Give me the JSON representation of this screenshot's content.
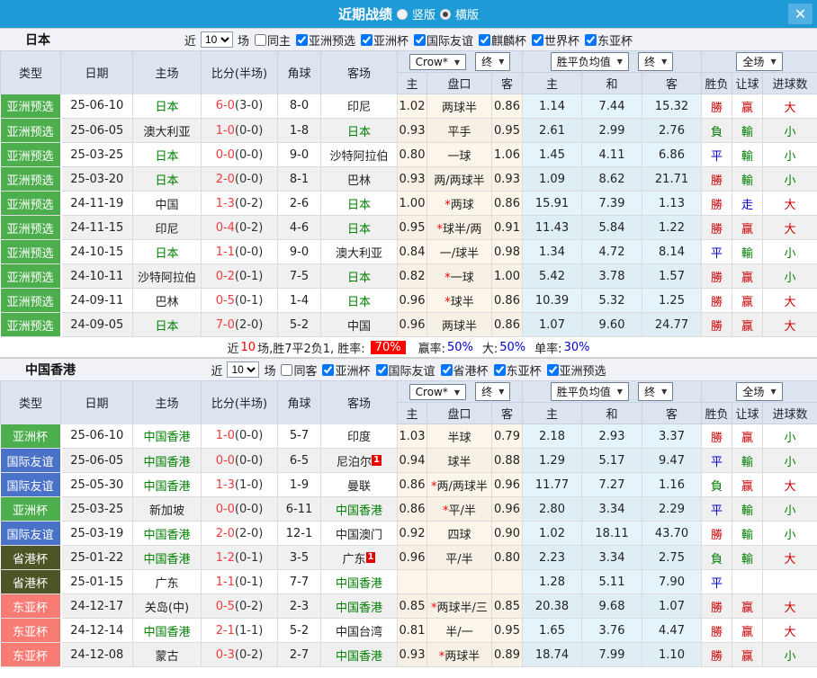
{
  "palette": {
    "topbar": "#1E9BD7",
    "close_btn": "#54AFE2",
    "header_bg": "#DCE4F0",
    "section_bg": "#F1F2F7",
    "type_green": "#4CAE4C",
    "type_blue": "#4A72C8",
    "type_olive": "#4D5426",
    "type_salmon": "#F87C74",
    "focal_team": "#008000",
    "score_red": "#F23B3B",
    "win": "#CC0000",
    "lose": "#008000",
    "draw": "#0000CC",
    "rate_badge_bg": "#FF0000",
    "rate_value_blue": "#0000CC"
  },
  "titlebar": {
    "title": "近期战绩",
    "radio_vertical": "竖版",
    "radio_horizontal": "横版",
    "close": "✕"
  },
  "columns": {
    "type": "类型",
    "date": "日期",
    "home": "主场",
    "score": "比分(半场)",
    "corner": "角球",
    "away": "客场",
    "odds_home": "主",
    "handicap": "盘口",
    "odds_away": "客",
    "mean_home": "主",
    "mean_draw": "和",
    "mean_away": "客",
    "wdl": "胜负",
    "handicap_result": "让球",
    "goals": "进球数"
  },
  "controls": {
    "source": "Crow*",
    "final1": "终",
    "mean": "胜平负均值",
    "final2": "终",
    "scope": "全场"
  },
  "sections": [
    {
      "team": "日本",
      "filters": {
        "near_label": "近",
        "count": "10",
        "games_label": "场",
        "same_label": "同主",
        "same_checked": false,
        "cups": [
          "亚洲预选",
          "亚洲杯",
          "国际友谊",
          "麒麟杯",
          "世界杯",
          "东亚杯"
        ]
      },
      "rows": [
        {
          "type": "亚洲预选",
          "type_color": "green",
          "date": "25-06-10",
          "home": "日本",
          "home_focal": true,
          "home_badge": "",
          "score": "6-0",
          "half": "(3-0)",
          "corner": "8-0",
          "away": "印尼",
          "away_focal": false,
          "away_badge": "",
          "odds_home": "1.02",
          "handicap": "两球半",
          "handicap_star": false,
          "odds_away": "0.86",
          "mean_home": "1.14",
          "mean_draw": "7.44",
          "mean_away": "15.32",
          "res_wdl": "勝",
          "res_wdl_c": "red",
          "res_let": "赢",
          "res_let_c": "red",
          "res_goal": "大",
          "res_goal_c": "red"
        },
        {
          "type": "亚洲预选",
          "type_color": "green",
          "date": "25-06-05",
          "home": "澳大利亚",
          "home_focal": false,
          "home_badge": "",
          "score": "1-0",
          "half": "(0-0)",
          "corner": "1-8",
          "away": "日本",
          "away_focal": true,
          "away_badge": "",
          "odds_home": "0.93",
          "handicap": "平手",
          "handicap_star": false,
          "odds_away": "0.95",
          "mean_home": "2.61",
          "mean_draw": "2.99",
          "mean_away": "2.76",
          "res_wdl": "負",
          "res_wdl_c": "green",
          "res_let": "輸",
          "res_let_c": "green",
          "res_goal": "小",
          "res_goal_c": "green"
        },
        {
          "type": "亚洲预选",
          "type_color": "green",
          "date": "25-03-25",
          "home": "日本",
          "home_focal": true,
          "home_badge": "",
          "score": "0-0",
          "half": "(0-0)",
          "corner": "9-0",
          "away": "沙特阿拉伯",
          "away_focal": false,
          "away_badge": "",
          "odds_home": "0.80",
          "handicap": "一球",
          "handicap_star": false,
          "odds_away": "1.06",
          "mean_home": "1.45",
          "mean_draw": "4.11",
          "mean_away": "6.86",
          "res_wdl": "平",
          "res_wdl_c": "blue",
          "res_let": "輸",
          "res_let_c": "green",
          "res_goal": "小",
          "res_goal_c": "green"
        },
        {
          "type": "亚洲预选",
          "type_color": "green",
          "date": "25-03-20",
          "home": "日本",
          "home_focal": true,
          "home_badge": "",
          "score": "2-0",
          "half": "(0-0)",
          "corner": "8-1",
          "away": "巴林",
          "away_focal": false,
          "away_badge": "",
          "odds_home": "0.93",
          "handicap": "两/两球半",
          "handicap_star": false,
          "odds_away": "0.93",
          "mean_home": "1.09",
          "mean_draw": "8.62",
          "mean_away": "21.71",
          "res_wdl": "勝",
          "res_wdl_c": "red",
          "res_let": "輸",
          "res_let_c": "green",
          "res_goal": "小",
          "res_goal_c": "green"
        },
        {
          "type": "亚洲预选",
          "type_color": "green",
          "date": "24-11-19",
          "home": "中国",
          "home_focal": false,
          "home_badge": "",
          "score": "1-3",
          "half": "(0-2)",
          "corner": "2-6",
          "away": "日本",
          "away_focal": true,
          "away_badge": "",
          "odds_home": "1.00",
          "handicap": "两球",
          "handicap_star": true,
          "odds_away": "0.86",
          "mean_home": "15.91",
          "mean_draw": "7.39",
          "mean_away": "1.13",
          "res_wdl": "勝",
          "res_wdl_c": "red",
          "res_let": "走",
          "res_let_c": "blue",
          "res_goal": "大",
          "res_goal_c": "red"
        },
        {
          "type": "亚洲预选",
          "type_color": "green",
          "date": "24-11-15",
          "home": "印尼",
          "home_focal": false,
          "home_badge": "",
          "score": "0-4",
          "half": "(0-2)",
          "corner": "4-6",
          "away": "日本",
          "away_focal": true,
          "away_badge": "",
          "odds_home": "0.95",
          "handicap": "球半/两",
          "handicap_star": true,
          "odds_away": "0.91",
          "mean_home": "11.43",
          "mean_draw": "5.84",
          "mean_away": "1.22",
          "res_wdl": "勝",
          "res_wdl_c": "red",
          "res_let": "赢",
          "res_let_c": "red",
          "res_goal": "大",
          "res_goal_c": "red"
        },
        {
          "type": "亚洲预选",
          "type_color": "green",
          "date": "24-10-15",
          "home": "日本",
          "home_focal": true,
          "home_badge": "",
          "score": "1-1",
          "half": "(0-0)",
          "corner": "9-0",
          "away": "澳大利亚",
          "away_focal": false,
          "away_badge": "",
          "odds_home": "0.84",
          "handicap": "一/球半",
          "handicap_star": false,
          "odds_away": "0.98",
          "mean_home": "1.34",
          "mean_draw": "4.72",
          "mean_away": "8.14",
          "res_wdl": "平",
          "res_wdl_c": "blue",
          "res_let": "輸",
          "res_let_c": "green",
          "res_goal": "小",
          "res_goal_c": "green"
        },
        {
          "type": "亚洲预选",
          "type_color": "green",
          "date": "24-10-11",
          "home": "沙特阿拉伯",
          "home_focal": false,
          "home_badge": "",
          "score": "0-2",
          "half": "(0-1)",
          "corner": "7-5",
          "away": "日本",
          "away_focal": true,
          "away_badge": "",
          "odds_home": "0.82",
          "handicap": "一球",
          "handicap_star": true,
          "odds_away": "1.00",
          "mean_home": "5.42",
          "mean_draw": "3.78",
          "mean_away": "1.57",
          "res_wdl": "勝",
          "res_wdl_c": "red",
          "res_let": "赢",
          "res_let_c": "red",
          "res_goal": "小",
          "res_goal_c": "green"
        },
        {
          "type": "亚洲预选",
          "type_color": "green",
          "date": "24-09-11",
          "home": "巴林",
          "home_focal": false,
          "home_badge": "",
          "score": "0-5",
          "half": "(0-1)",
          "corner": "1-4",
          "away": "日本",
          "away_focal": true,
          "away_badge": "",
          "odds_home": "0.96",
          "handicap": "球半",
          "handicap_star": true,
          "odds_away": "0.86",
          "mean_home": "10.39",
          "mean_draw": "5.32",
          "mean_away": "1.25",
          "res_wdl": "勝",
          "res_wdl_c": "red",
          "res_let": "赢",
          "res_let_c": "red",
          "res_goal": "大",
          "res_goal_c": "red"
        },
        {
          "type": "亚洲预选",
          "type_color": "green",
          "date": "24-09-05",
          "home": "日本",
          "home_focal": true,
          "home_badge": "",
          "score": "7-0",
          "half": "(2-0)",
          "corner": "5-2",
          "away": "中国",
          "away_focal": false,
          "away_badge": "",
          "odds_home": "0.96",
          "handicap": "两球半",
          "handicap_star": false,
          "odds_away": "0.86",
          "mean_home": "1.07",
          "mean_draw": "9.60",
          "mean_away": "24.77",
          "res_wdl": "勝",
          "res_wdl_c": "red",
          "res_let": "赢",
          "res_let_c": "red",
          "res_goal": "大",
          "res_goal_c": "red"
        }
      ],
      "summary": {
        "prefix": "近",
        "count": "10",
        "mid": "场,胜7平2负1, 胜率:",
        "win_rate": "70%",
        "label2": "赢率:",
        "value2": "50%",
        "label3": "大:",
        "value3": "50%",
        "label4": "单率:",
        "value4": "30%"
      }
    },
    {
      "team": "中国香港",
      "filters": {
        "near_label": "近",
        "count": "10",
        "games_label": "场",
        "same_label": "同客",
        "same_checked": false,
        "cups": [
          "亚洲杯",
          "国际友谊",
          "省港杯",
          "东亚杯",
          "亚洲预选"
        ]
      },
      "rows": [
        {
          "type": "亚洲杯",
          "type_color": "green",
          "date": "25-06-10",
          "home": "中国香港",
          "home_focal": true,
          "home_badge": "",
          "score": "1-0",
          "half": "(0-0)",
          "corner": "5-7",
          "away": "印度",
          "away_focal": false,
          "away_badge": "",
          "odds_home": "1.03",
          "handicap": "半球",
          "handicap_star": false,
          "odds_away": "0.79",
          "mean_home": "2.18",
          "mean_draw": "2.93",
          "mean_away": "3.37",
          "res_wdl": "勝",
          "res_wdl_c": "red",
          "res_let": "赢",
          "res_let_c": "red",
          "res_goal": "小",
          "res_goal_c": "green"
        },
        {
          "type": "国际友谊",
          "type_color": "blue",
          "date": "25-06-05",
          "home": "中国香港",
          "home_focal": true,
          "home_badge": "",
          "score": "0-0",
          "half": "(0-0)",
          "corner": "6-5",
          "away": "尼泊尔",
          "away_focal": false,
          "away_badge": "1",
          "odds_home": "0.94",
          "handicap": "球半",
          "handicap_star": false,
          "odds_away": "0.88",
          "mean_home": "1.29",
          "mean_draw": "5.17",
          "mean_away": "9.47",
          "res_wdl": "平",
          "res_wdl_c": "blue",
          "res_let": "輸",
          "res_let_c": "green",
          "res_goal": "小",
          "res_goal_c": "green"
        },
        {
          "type": "国际友谊",
          "type_color": "blue",
          "date": "25-05-30",
          "home": "中国香港",
          "home_focal": true,
          "home_badge": "",
          "score": "1-3",
          "half": "(1-0)",
          "corner": "1-9",
          "away": "曼联",
          "away_focal": false,
          "away_badge": "",
          "odds_home": "0.86",
          "handicap": "两/两球半",
          "handicap_star": true,
          "odds_away": "0.96",
          "mean_home": "11.77",
          "mean_draw": "7.27",
          "mean_away": "1.16",
          "res_wdl": "負",
          "res_wdl_c": "green",
          "res_let": "赢",
          "res_let_c": "red",
          "res_goal": "大",
          "res_goal_c": "red"
        },
        {
          "type": "亚洲杯",
          "type_color": "green",
          "date": "25-03-25",
          "home": "新加坡",
          "home_focal": false,
          "home_badge": "",
          "score": "0-0",
          "half": "(0-0)",
          "corner": "6-11",
          "away": "中国香港",
          "away_focal": true,
          "away_badge": "",
          "odds_home": "0.86",
          "handicap": "平/半",
          "handicap_star": true,
          "odds_away": "0.96",
          "mean_home": "2.80",
          "mean_draw": "3.34",
          "mean_away": "2.29",
          "res_wdl": "平",
          "res_wdl_c": "blue",
          "res_let": "輸",
          "res_let_c": "green",
          "res_goal": "小",
          "res_goal_c": "green"
        },
        {
          "type": "国际友谊",
          "type_color": "blue",
          "date": "25-03-19",
          "home": "中国香港",
          "home_focal": true,
          "home_badge": "",
          "score": "2-0",
          "half": "(2-0)",
          "corner": "12-1",
          "away": "中国澳门",
          "away_focal": false,
          "away_badge": "",
          "odds_home": "0.92",
          "handicap": "四球",
          "handicap_star": false,
          "odds_away": "0.90",
          "mean_home": "1.02",
          "mean_draw": "18.11",
          "mean_away": "43.70",
          "res_wdl": "勝",
          "res_wdl_c": "red",
          "res_let": "輸",
          "res_let_c": "green",
          "res_goal": "小",
          "res_goal_c": "green"
        },
        {
          "type": "省港杯",
          "type_color": "olive",
          "date": "25-01-22",
          "home": "中国香港",
          "home_focal": true,
          "home_badge": "",
          "score": "1-2",
          "half": "(0-1)",
          "corner": "3-5",
          "away": "广东",
          "away_focal": false,
          "away_badge": "1",
          "odds_home": "0.96",
          "handicap": "平/半",
          "handicap_star": false,
          "odds_away": "0.80",
          "mean_home": "2.23",
          "mean_draw": "3.34",
          "mean_away": "2.75",
          "res_wdl": "負",
          "res_wdl_c": "green",
          "res_let": "輸",
          "res_let_c": "green",
          "res_goal": "大",
          "res_goal_c": "red"
        },
        {
          "type": "省港杯",
          "type_color": "olive",
          "date": "25-01-15",
          "home": "广东",
          "home_focal": false,
          "home_badge": "",
          "score": "1-1",
          "half": "(0-1)",
          "corner": "7-7",
          "away": "中国香港",
          "away_focal": true,
          "away_badge": "",
          "odds_home": "",
          "handicap": "",
          "handicap_star": false,
          "odds_away": "",
          "mean_home": "1.28",
          "mean_draw": "5.11",
          "mean_away": "7.90",
          "res_wdl": "平",
          "res_wdl_c": "blue",
          "res_let": "",
          "res_let_c": "",
          "res_goal": "",
          "res_goal_c": ""
        },
        {
          "type": "东亚杯",
          "type_color": "salmon",
          "date": "24-12-17",
          "home": "关岛(中)",
          "home_focal": false,
          "home_badge": "",
          "score": "0-5",
          "half": "(0-2)",
          "corner": "2-3",
          "away": "中国香港",
          "away_focal": true,
          "away_badge": "",
          "odds_home": "0.85",
          "handicap": "两球半/三",
          "handicap_star": true,
          "odds_away": "0.85",
          "mean_home": "20.38",
          "mean_draw": "9.68",
          "mean_away": "1.07",
          "res_wdl": "勝",
          "res_wdl_c": "red",
          "res_let": "赢",
          "res_let_c": "red",
          "res_goal": "大",
          "res_goal_c": "red"
        },
        {
          "type": "东亚杯",
          "type_color": "salmon",
          "date": "24-12-14",
          "home": "中国香港",
          "home_focal": true,
          "home_badge": "",
          "score": "2-1",
          "half": "(1-1)",
          "corner": "5-2",
          "away": "中国台湾",
          "away_focal": false,
          "away_badge": "",
          "odds_home": "0.81",
          "handicap": "半/一",
          "handicap_star": false,
          "odds_away": "0.95",
          "mean_home": "1.65",
          "mean_draw": "3.76",
          "mean_away": "4.47",
          "res_wdl": "勝",
          "res_wdl_c": "red",
          "res_let": "赢",
          "res_let_c": "red",
          "res_goal": "大",
          "res_goal_c": "red"
        },
        {
          "type": "东亚杯",
          "type_color": "salmon",
          "date": "24-12-08",
          "home": "蒙古",
          "home_focal": false,
          "home_badge": "",
          "score": "0-3",
          "half": "(0-2)",
          "corner": "2-7",
          "away": "中国香港",
          "away_focal": true,
          "away_badge": "",
          "odds_home": "0.93",
          "handicap": "两球半",
          "handicap_star": true,
          "odds_away": "0.89",
          "mean_home": "18.74",
          "mean_draw": "7.99",
          "mean_away": "1.10",
          "res_wdl": "勝",
          "res_wdl_c": "red",
          "res_let": "赢",
          "res_let_c": "red",
          "res_goal": "小",
          "res_goal_c": "green"
        }
      ],
      "summary": null
    }
  ]
}
